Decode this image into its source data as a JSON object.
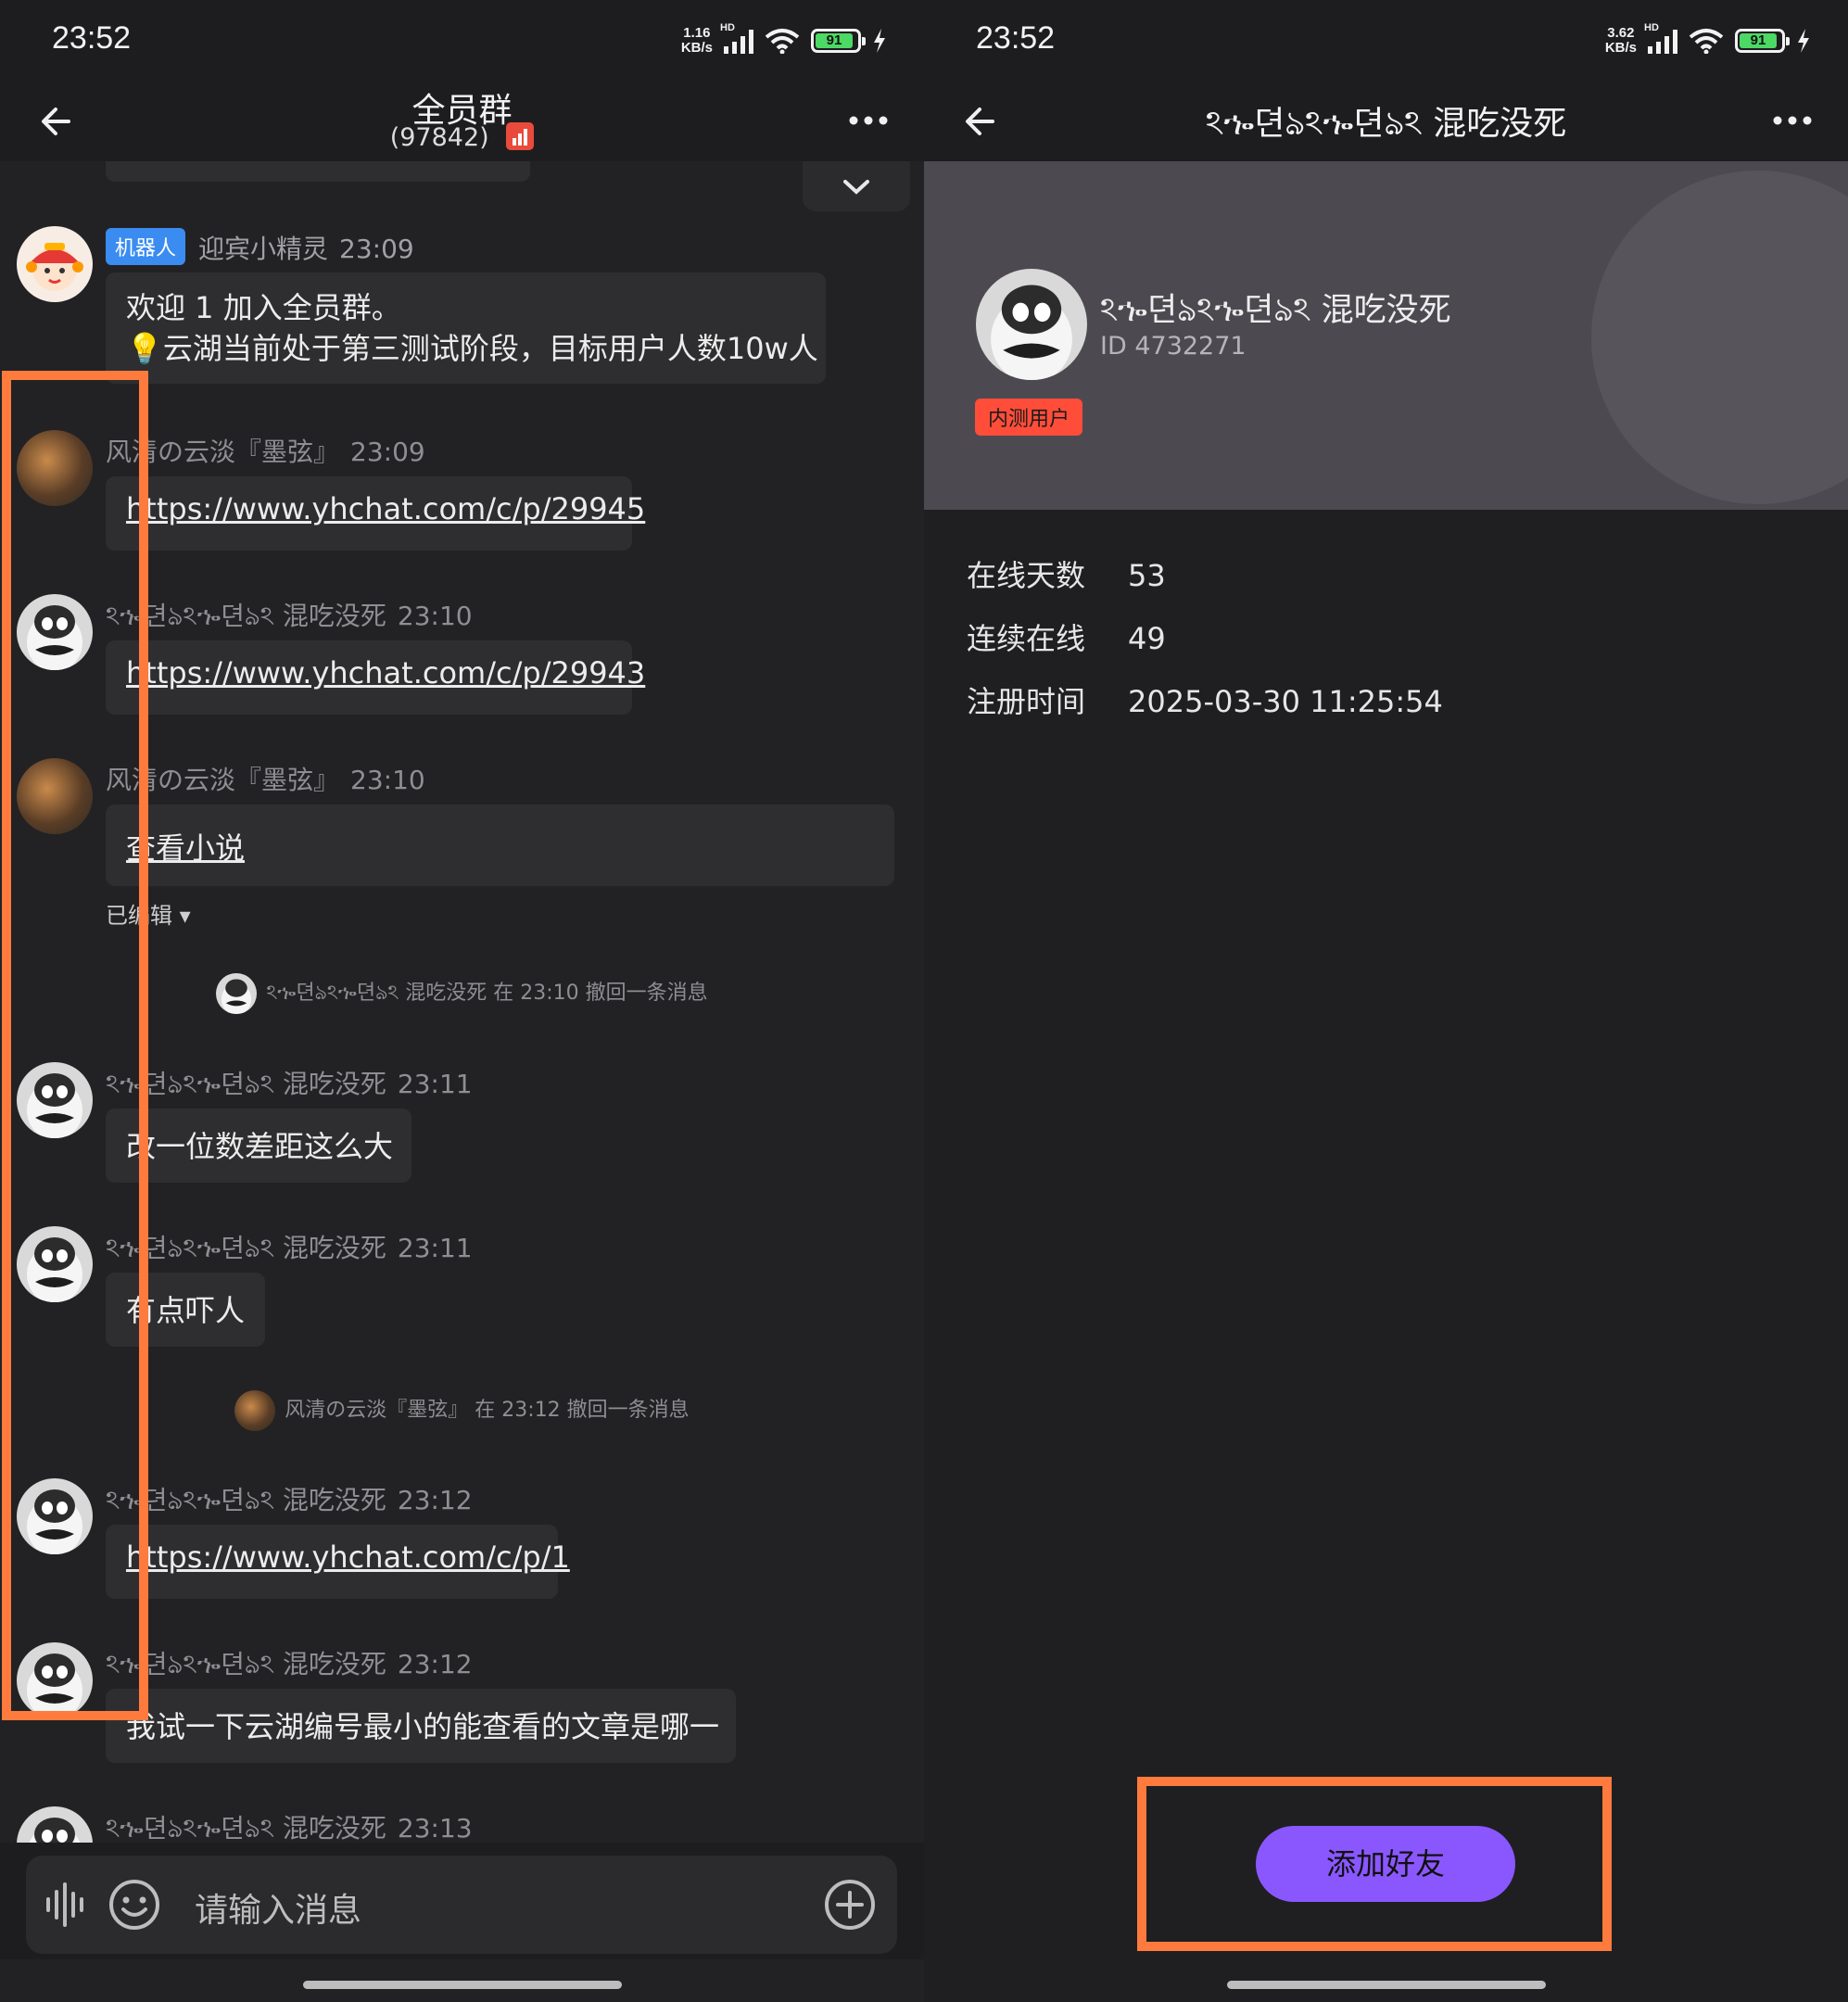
{
  "left": {
    "status": {
      "time": "23:52",
      "speed_top": "1.16",
      "speed_unit": "KB/s",
      "hd": "HD",
      "battery": "91"
    },
    "header": {
      "title": "全员群",
      "count": "(97842)"
    },
    "messages": [
      {
        "tag": "机器人",
        "name": "迎宾小精灵",
        "time": "23:09",
        "line1": "欢迎 1 加入全员群。",
        "line2": "💡云湖当前处于第三测试阶段，目标用户人数10w人"
      },
      {
        "name": "风清の云淡『墨弦』",
        "time": "23:09",
        "text": "https://www.yhchat.com/c/p/29945"
      },
      {
        "name": "ঽኈ뎐ঌঽኈ뎐ঌঽ 混吃没死",
        "time": "23:10",
        "text": "https://www.yhchat.com/c/p/29943"
      },
      {
        "name": "风清の云淡『墨弦』",
        "time": "23:10",
        "text": "查看小说",
        "edited": "已编辑"
      },
      {
        "name": "ঽኈ뎐ঌঽኈ뎐ঌঽ 混吃没死",
        "time": "23:11",
        "text": "改一位数差距这么大"
      },
      {
        "name": "ঽኈ뎐ঌঽኈ뎐ঌঽ 混吃没死",
        "time": "23:11",
        "text": "有点吓人"
      },
      {
        "name": "ঽኈ뎐ঌঽኈ뎐ঌঽ 混吃没死",
        "time": "23:12",
        "text": "https://www.yhchat.com/c/p/1"
      },
      {
        "name": "ঽኈ뎐ঌঽኈ뎐ঌঽ 混吃没死",
        "time": "23:12",
        "text": "我试一下云湖编号最小的能查看的文章是哪一"
      },
      {
        "name": "ঽኈ뎐ঌঽኈ뎐ঌঽ 混吃没死",
        "time": "23:13"
      }
    ],
    "system": [
      "ঽኈ뎐ঌঽኈ뎐ঌঽ 混吃没死 在 23:10 撤回一条消息",
      "风清の云淡『墨弦』 在 23:12 撤回一条消息"
    ],
    "input": {
      "placeholder": "请输入消息"
    }
  },
  "right": {
    "status": {
      "time": "23:52",
      "speed_top": "3.62",
      "speed_unit": "KB/s",
      "hd": "HD",
      "battery": "91"
    },
    "header": {
      "title": "ঽኈ뎐ঌঽኈ뎐ঌঽ 混吃没死"
    },
    "profile": {
      "name": "ঽኈ뎐ঌঽኈ뎐ঌঽ 混吃没死",
      "id": "ID 4732271",
      "badge": "内测用户"
    },
    "stats": [
      {
        "label": "在线天数",
        "value": "53"
      },
      {
        "label": "连续在线",
        "value": "49"
      },
      {
        "label": "注册时间",
        "value": "2025-03-30 11:25:54"
      }
    ],
    "add_button": "添加好友"
  },
  "colors": {
    "highlight": "#ff7a3d",
    "accent": "#8a57ff",
    "bot_tag": "#3a8cf0",
    "badge": "#ff4d3a"
  }
}
